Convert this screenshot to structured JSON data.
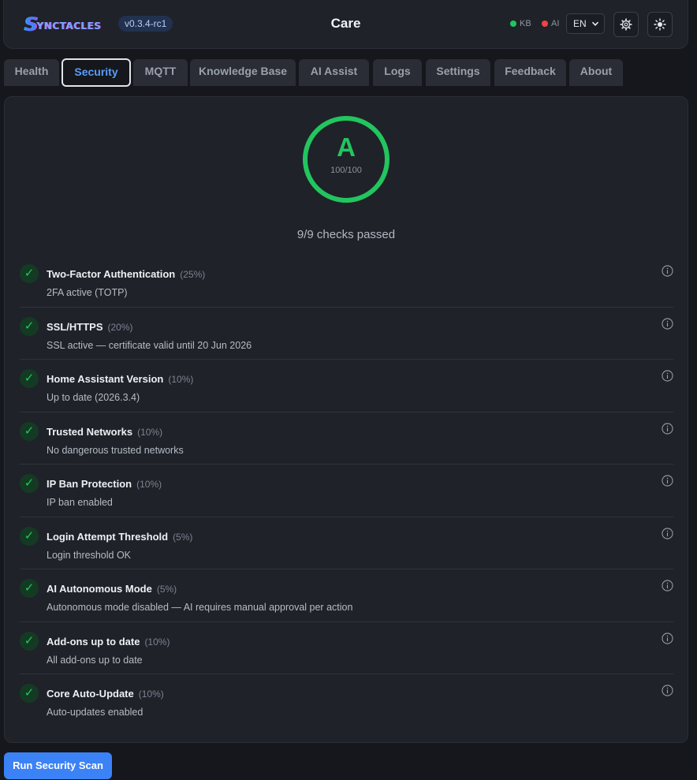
{
  "header": {
    "logo_initial": "S",
    "logo_rest": "YNCTACLES",
    "version": "v0.3.4-rc1",
    "title": "Care",
    "status": [
      {
        "label": "KB",
        "color": "#22c55e"
      },
      {
        "label": "AI",
        "color": "#ef4444"
      }
    ],
    "language": "EN",
    "settings_icon": "gear-icon",
    "theme_icon": "sun-icon"
  },
  "tabs": [
    {
      "label": "Health",
      "active": false
    },
    {
      "label": "Security",
      "active": true
    },
    {
      "label": "MQTT",
      "active": false
    },
    {
      "label": "Knowledge Base",
      "active": false
    },
    {
      "label": "AI Assist",
      "active": false
    },
    {
      "label": "Logs",
      "active": false
    },
    {
      "label": "Settings",
      "active": false
    },
    {
      "label": "Feedback",
      "active": false
    },
    {
      "label": "About",
      "active": false
    }
  ],
  "security": {
    "grade": "A",
    "score": "100/100",
    "summary": "9/9 checks passed",
    "checks": [
      {
        "name": "Two-Factor Authentication",
        "weight": "(25%)",
        "desc": "2FA active (TOTP)",
        "passed": true
      },
      {
        "name": "SSL/HTTPS",
        "weight": "(20%)",
        "desc": "SSL active — certificate valid until 20 Jun 2026",
        "passed": true
      },
      {
        "name": "Home Assistant Version",
        "weight": "(10%)",
        "desc": "Up to date (2026.3.4)",
        "passed": true
      },
      {
        "name": "Trusted Networks",
        "weight": "(10%)",
        "desc": "No dangerous trusted networks",
        "passed": true
      },
      {
        "name": "IP Ban Protection",
        "weight": "(10%)",
        "desc": "IP ban enabled",
        "passed": true
      },
      {
        "name": "Login Attempt Threshold",
        "weight": "(5%)",
        "desc": "Login threshold OK",
        "passed": true
      },
      {
        "name": "AI Autonomous Mode",
        "weight": "(5%)",
        "desc": "Autonomous mode disabled — AI requires manual approval per action",
        "passed": true
      },
      {
        "name": "Add-ons up to date",
        "weight": "(10%)",
        "desc": "All add-ons up to date",
        "passed": true
      },
      {
        "name": "Core Auto-Update",
        "weight": "(10%)",
        "desc": "Auto-updates enabled",
        "passed": true
      }
    ],
    "check_icon": "checkmark-icon",
    "info_icon": "info-icon",
    "scan_button": "Run Security Scan"
  },
  "colors": {
    "accent": "#3b82f6",
    "pass": "#22c55e",
    "background": "#15171c",
    "panel": "#1f2229"
  }
}
